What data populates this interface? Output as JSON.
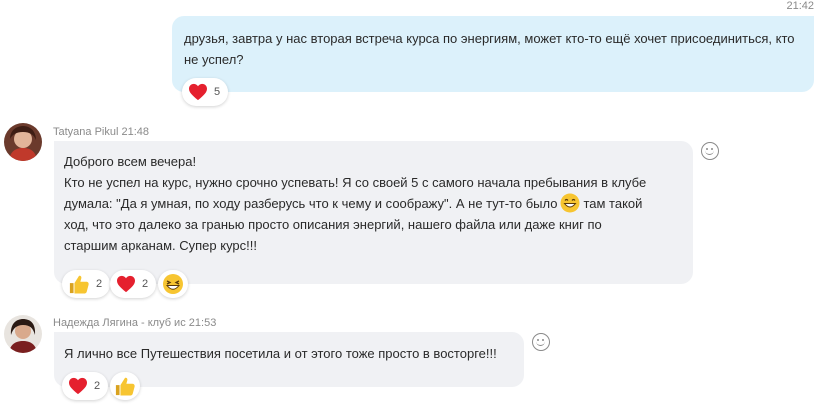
{
  "messages": [
    {
      "time": "21:42",
      "text": "друзья, завтра у нас вторая встреча курса по энергиям, может кто-то ещё хочет присоединиться, кто не успел?",
      "reactions": [
        {
          "icon": "heart-icon",
          "count": "5"
        }
      ]
    },
    {
      "sender": "Tatyana Pikul",
      "time": "21:48",
      "lines": [
        "Доброго всем вечера!",
        "Кто не успел на курс, нужно срочно успевать! Я со своей 5 с самого начала пребывания в клубе",
        "думала: \"Да я умная, по ходу разберусь что к чему и соображу\". А не тут-то было",
        "там такой",
        "ход, что это далеко за гранью просто описания энергий, нашего файла или даже книг по",
        "старшим арканам. Супер курс!!!"
      ],
      "inline_emoji": "grinning-face-icon",
      "reactions": [
        {
          "icon": "thumbs-up-icon",
          "count": "2"
        },
        {
          "icon": "heart-icon",
          "count": "2"
        },
        {
          "icon": "laughing-face-icon",
          "count": ""
        }
      ]
    },
    {
      "sender": "Надежда Лягина - клуб ис",
      "time": "21:53",
      "text": "Я лично все Путешествия посетила и от этого тоже просто в восторге!!!",
      "reactions": [
        {
          "icon": "heart-icon",
          "count": "2"
        },
        {
          "icon": "thumbs-up-icon",
          "count": ""
        }
      ]
    }
  ],
  "colors": {
    "outgoing_bubble": "#dcf1fb",
    "incoming_bubble": "#f0f1f4",
    "heart": "#e5202e",
    "emoji_yellow": "#f7c531"
  }
}
